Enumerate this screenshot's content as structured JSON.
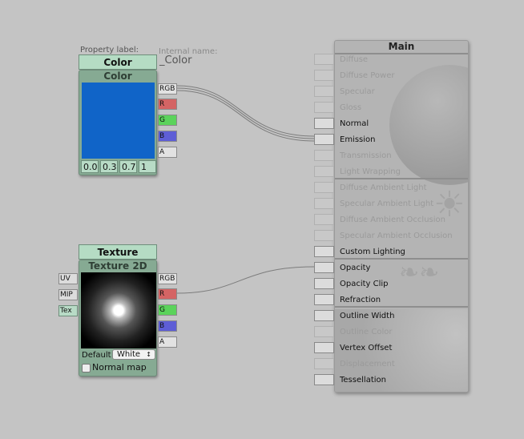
{
  "color_node": {
    "property_label_caption": "Property label:",
    "property_label_value": "Color",
    "internal_name_caption": "Internal name:",
    "internal_name_value": "_Color",
    "title": "Color",
    "swatch_color": "#1064c8",
    "values": [
      "0.0",
      "0.3",
      "0.7",
      "1"
    ],
    "outputs": [
      "RGB",
      "R",
      "G",
      "B",
      "A"
    ]
  },
  "texture_node": {
    "property_label_value": "Texture",
    "title": "Texture 2D",
    "inputs": [
      "UV",
      "MIP",
      "Tex"
    ],
    "outputs": [
      "RGB",
      "R",
      "G",
      "B",
      "A"
    ],
    "default_label": "Default",
    "default_value": "White",
    "normal_map_label": "Normal map",
    "normal_map_checked": false
  },
  "main_node": {
    "title": "Main",
    "inputs": [
      {
        "label": "Diffuse",
        "active": false
      },
      {
        "label": "Diffuse Power",
        "active": false
      },
      {
        "label": "Specular",
        "active": false
      },
      {
        "label": "Gloss",
        "active": false
      },
      {
        "label": "Normal",
        "active": true
      },
      {
        "label": "Emission",
        "active": true
      },
      {
        "label": "Transmission",
        "active": false
      },
      {
        "label": "Light Wrapping",
        "active": false
      },
      {
        "label": "Diffuse Ambient Light",
        "active": false
      },
      {
        "label": "Specular Ambient Light",
        "active": false
      },
      {
        "label": "Diffuse Ambient Occlusion",
        "active": false
      },
      {
        "label": "Specular Ambient Occlusion",
        "active": false
      },
      {
        "label": "Custom Lighting",
        "active": true
      },
      {
        "label": "Opacity",
        "active": true
      },
      {
        "label": "Opacity Clip",
        "active": true
      },
      {
        "label": "Refraction",
        "active": true
      },
      {
        "label": "Outline Width",
        "active": true
      },
      {
        "label": "Outline Color",
        "active": false
      },
      {
        "label": "Vertex Offset",
        "active": true
      },
      {
        "label": "Displacement",
        "active": false
      },
      {
        "label": "Tessellation",
        "active": true
      }
    ]
  },
  "connections": [
    {
      "from": "Color.RGB",
      "to": "Main.Emission"
    },
    {
      "from": "Texture 2D.R",
      "to": "Main.Opacity"
    }
  ]
}
